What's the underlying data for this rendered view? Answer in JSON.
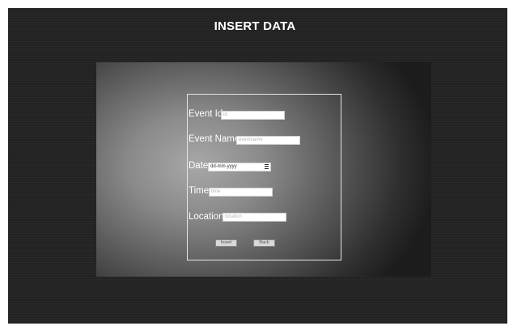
{
  "header": {
    "title": "INSERT DATA"
  },
  "form": {
    "event_id": {
      "label": "Event Id:",
      "placeholder": "id"
    },
    "event_name": {
      "label": "Event Name:",
      "placeholder": "eventname"
    },
    "date": {
      "label": "Date:",
      "value": "dd-mm-yyyy"
    },
    "time": {
      "label": "Time:",
      "placeholder": "time"
    },
    "location": {
      "label": "Location:",
      "placeholder": "location"
    },
    "insert_label": "Insert",
    "back_label": "Back"
  },
  "icons": {
    "date_picker": "calendar-icon"
  },
  "colors": {
    "page_background": "#232323",
    "text": "#ffffff",
    "form_border": "#e4e4e4"
  }
}
